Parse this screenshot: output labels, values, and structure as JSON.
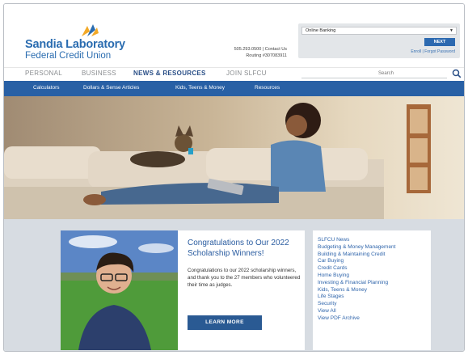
{
  "colors": {
    "brand_blue": "#2a6cb0",
    "nav_active": "#2a4f87",
    "subnav_bg": "#2860a5",
    "button_bg": "#2a5a93",
    "lower_bg": "#d7dce2",
    "link": "#2f65ab"
  },
  "header": {
    "logo_line1": "Sandia Laboratory",
    "logo_line2": "Federal Credit Union",
    "logo_icon": "slfcu-logo-icon",
    "phone": "505.293.0500",
    "contact_link": "Contact Us",
    "routing": "Routing #307083911"
  },
  "login": {
    "select_value": "Online Banking",
    "next_label": "NEXT",
    "enroll_link": "Enroll",
    "forgot_link": "Forgot Password",
    "separator": "|"
  },
  "nav": {
    "tabs": [
      {
        "label": "PERSONAL"
      },
      {
        "label": "BUSINESS"
      },
      {
        "label": "NEWS & RESOURCES"
      },
      {
        "label": "JOIN SLFCU"
      }
    ],
    "search_placeholder": "Search",
    "search_icon": "search-icon"
  },
  "subnav": {
    "items": [
      {
        "label": "Calculators"
      },
      {
        "label": "Dollars & Sense Articles"
      },
      {
        "label": "Kids, Teens & Money"
      },
      {
        "label": "Resources"
      }
    ]
  },
  "feature": {
    "title": "Congratulations to Our 2022 Scholarship Winners!",
    "body": "Congratulations to our 2022 scholarship winners, and thank you to the 27 members who volunteered their time as judges.",
    "button": "LEARN MORE"
  },
  "links": [
    "SLFCU News",
    "Budgeting & Money Management",
    "Building & Maintaining Credit",
    "Car Buying",
    "Credit Cards",
    "Home Buying",
    "Investing & Financial Planning",
    "Kids, Teens & Money",
    "Life Stages",
    "Security",
    "View All",
    "View PDF Archive"
  ]
}
